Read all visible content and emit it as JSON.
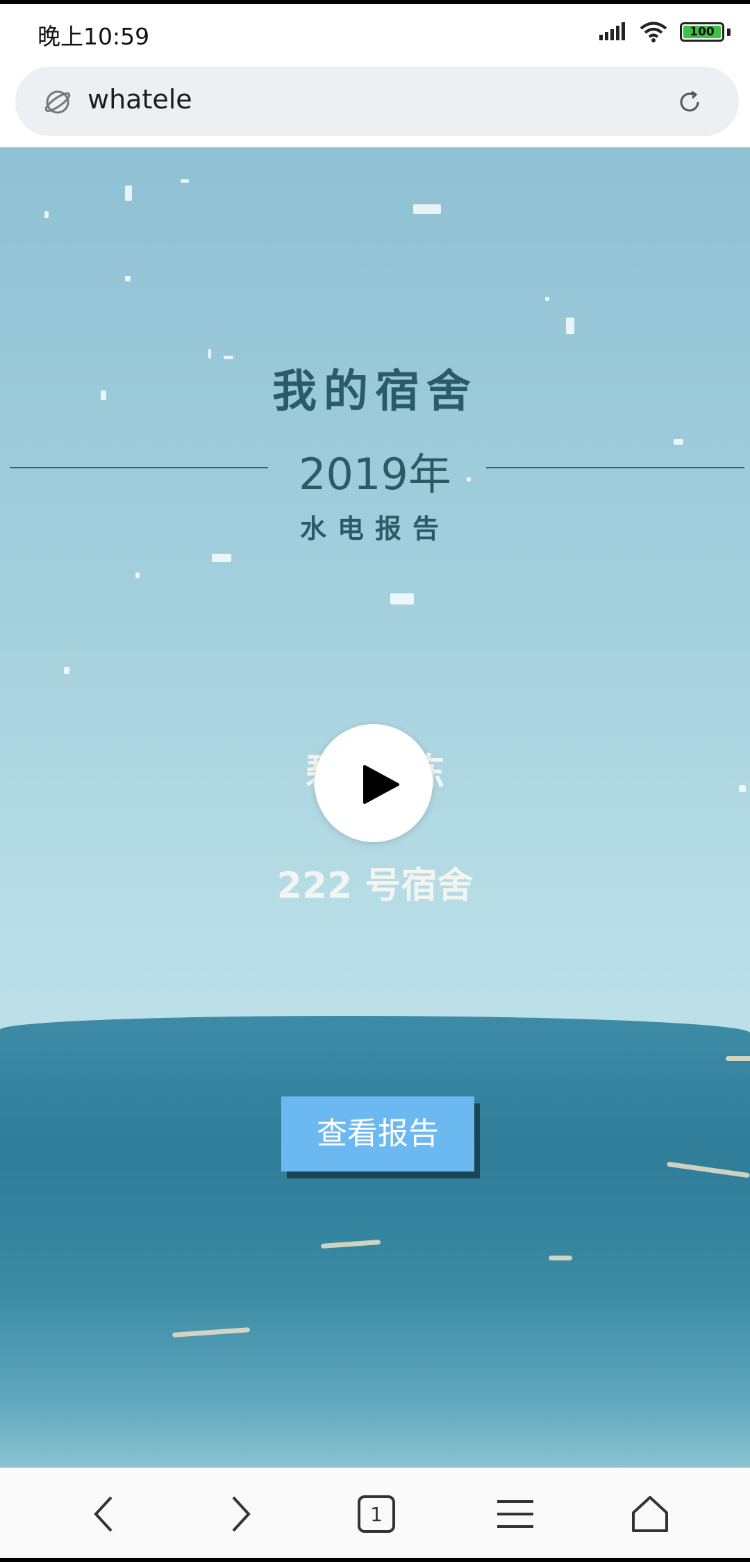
{
  "status_bar": {
    "time": "晚上10:59",
    "battery": "100"
  },
  "browser": {
    "url_text": "whatele"
  },
  "page": {
    "title": "我的宿舍",
    "year": "2019年",
    "subtitle": "水电报告",
    "building": "碧桂8栋",
    "room": "222 号宿舍",
    "view_report_label": "查看报告"
  },
  "bottom_nav": {
    "tab_count": "1"
  },
  "icons": [
    "globe-icon",
    "reload-icon",
    "play-icon",
    "back-icon",
    "forward-icon",
    "tabs-icon",
    "menu-icon",
    "home-icon",
    "signal-icon",
    "wifi-icon",
    "battery-icon"
  ],
  "colors": {
    "accent_button": "#6cb9f2",
    "title_text": "#2b5b66",
    "sky_top": "#8fc1d4",
    "ground": "#2f7d99"
  }
}
